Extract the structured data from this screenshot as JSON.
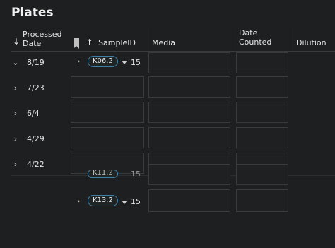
{
  "title": "Plates",
  "columns": {
    "processed_date": "Processed Date",
    "sample_id": "SampleID",
    "media": "Media",
    "date_counted": "Date Counted",
    "dilution": "Dilution"
  },
  "groups": [
    {
      "date": "8/19",
      "expanded": true
    },
    {
      "date": "7/23",
      "expanded": false
    },
    {
      "date": "6/4",
      "expanded": false
    },
    {
      "date": "4/29",
      "expanded": false
    },
    {
      "date": "4/22",
      "expanded": false
    }
  ],
  "rows": [
    {
      "sample_id": "K06.2",
      "count": "15"
    },
    {
      "sample_id": "K13.2",
      "count": "15"
    }
  ],
  "partial_pill_text": "K11.2",
  "partial_count": "15"
}
